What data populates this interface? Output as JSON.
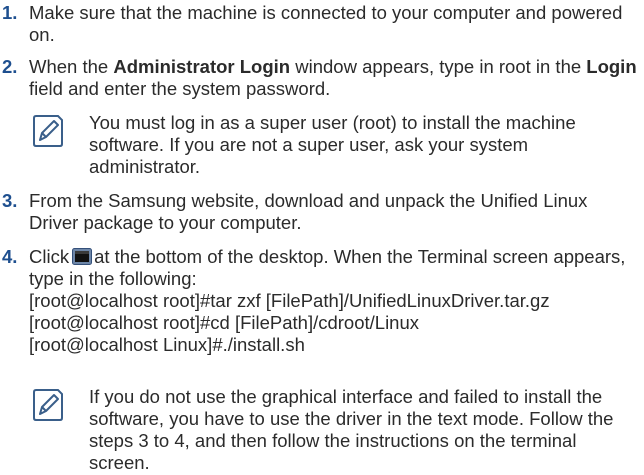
{
  "steps": [
    {
      "number": "1.",
      "text": "Make sure that the machine is connected to your computer and powered on."
    },
    {
      "number": "2.",
      "pre": "When the ",
      "bold1": "Administrator Login",
      "mid": " window appears, type in root in the ",
      "bold2": "Login",
      "post": " field and enter the system password."
    },
    {
      "number": "3.",
      "text": "From the Samsung website, download and unpack the Unified Linux Driver package to your computer."
    },
    {
      "number": "4.",
      "pre": "Click",
      "post": "at the bottom of the desktop. When the Terminal screen appears, type in the following:",
      "commands": [
        "[root@localhost root]#tar zxf [FilePath]/UnifiedLinuxDriver.tar.gz",
        "[root@localhost root]#cd [FilePath]/cdroot/Linux",
        "[root@localhost Linux]#./install.sh"
      ]
    }
  ],
  "notes": [
    {
      "icon": "note-pencil-icon",
      "text": "You must log in as a super user (root) to install the machine software. If you are not a super user, ask your system administrator."
    },
    {
      "icon": "note-pencil-icon",
      "text": "If you do not use the graphical interface and failed to install the software, you have to use the driver in the text mode. Follow the steps 3 to 4, and then follow the instructions on the terminal screen."
    }
  ],
  "colors": {
    "step_number": "#1e4f8f",
    "text": "#2b2b2b",
    "icon_stroke": "#3a5f8a"
  }
}
